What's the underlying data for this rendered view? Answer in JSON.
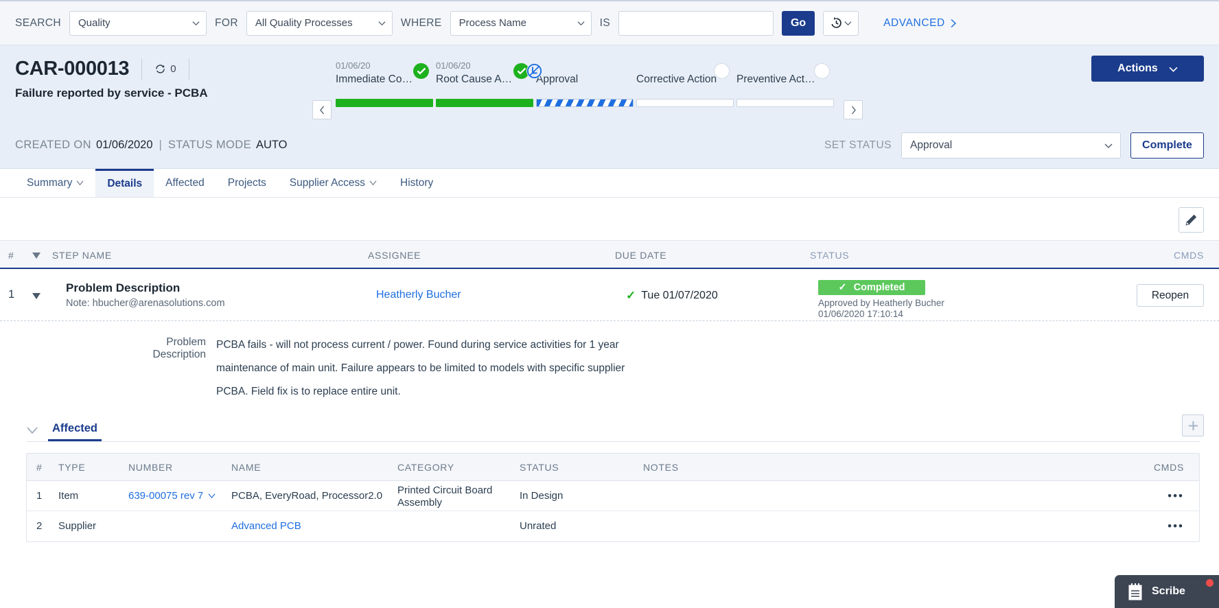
{
  "search": {
    "label_search": "SEARCH",
    "label_for": "FOR",
    "label_where": "WHERE",
    "label_is": "IS",
    "scope_value": "Quality",
    "scope_options": [
      "Quality"
    ],
    "for_value": "All Quality Processes",
    "for_options": [
      "All Quality Processes"
    ],
    "where_value": "Process Name",
    "where_options": [
      "Process Name"
    ],
    "query_value": "",
    "query_placeholder": "",
    "go_label": "Go",
    "history_icon": "history-clock-icon",
    "advanced_label": "ADVANCED"
  },
  "object_header": {
    "id": "CAR-000013",
    "revision_icon": "revision-loop-icon",
    "revision_count": "0",
    "subtitle": "Failure reported by service - PCBA",
    "actions_label": "Actions"
  },
  "workflow": {
    "prev_label": "‹",
    "next_label": "›",
    "steps": [
      {
        "date": "01/06/20",
        "name": "Immediate Co…",
        "state": "done",
        "badge": "check-circle-icon"
      },
      {
        "date": "01/06/20",
        "name": "Root Cause A…",
        "state": "done",
        "badge": "check-circle-icon"
      },
      {
        "date": "",
        "name": "Approval",
        "state": "active",
        "badge": "in-progress-icon"
      },
      {
        "date": "",
        "name": "Corrective Action",
        "state": "todo",
        "badge": "empty-circle-icon"
      },
      {
        "date": "",
        "name": "Preventive Act…",
        "state": "todo",
        "badge": "empty-circle-icon"
      }
    ]
  },
  "meta": {
    "created_label": "CREATED ON",
    "created_value": "01/06/2020",
    "pipe": "|",
    "status_mode_label": "STATUS MODE",
    "status_mode_value": "AUTO",
    "set_status_label": "SET STATUS",
    "set_status_value": "Approval",
    "set_status_options": [
      "Approval"
    ],
    "complete_label": "Complete"
  },
  "tabs": [
    {
      "label": "Summary",
      "active": false,
      "caret": true
    },
    {
      "label": "Details",
      "active": true,
      "caret": false
    },
    {
      "label": "Affected",
      "active": false,
      "caret": false
    },
    {
      "label": "Projects",
      "active": false,
      "caret": false
    },
    {
      "label": "Supplier Access",
      "active": false,
      "caret": true
    },
    {
      "label": "History",
      "active": false,
      "caret": false
    }
  ],
  "edit_row": {
    "pencil_icon": "pencil-edit-icon"
  },
  "steps_table": {
    "headers": {
      "num": "#",
      "step_name": "STEP NAME",
      "assignee": "ASSIGNEE",
      "due_date": "DUE DATE",
      "status": "STATUS",
      "cmds": "CMDS"
    },
    "row": {
      "num": "1",
      "name": "Problem Description",
      "note": "Note: hbucher@arenasolutions.com",
      "assignee": "Heatherly Bucher",
      "due_date": "Tue 01/07/2020",
      "due_check": "✓",
      "status_badge": "Completed",
      "status_check": "✓",
      "approved_by": "Approved by Heatherly Bucher",
      "approved_at": "01/06/2020 17:10:14",
      "cmd_label": "Reopen"
    }
  },
  "detail": {
    "field_label": "Problem Description",
    "lines": [
      "PCBA fails - will not process current / power. Found during service activities for 1 year",
      "maintenance of main unit. Failure appears to be limited to models with specific supplier",
      "PCBA. Field fix is to replace entire unit."
    ]
  },
  "affected": {
    "section_title": "Affected",
    "add_icon": "plus-icon",
    "collapse_icon": "chevron-down-icon",
    "headers": {
      "num": "#",
      "type": "TYPE",
      "number": "NUMBER",
      "name": "NAME",
      "category": "CATEGORY",
      "status": "STATUS",
      "notes": "NOTES",
      "cmds": "CMDS"
    },
    "rows": [
      {
        "num": "1",
        "type": "Item",
        "number": "639-00075 rev 7",
        "number_is_link": true,
        "number_caret": true,
        "name": "PCBA, EveryRoad, Processor2.0",
        "name_is_link": false,
        "category_line1": "Printed Circuit Board",
        "category_line2": "Assembly",
        "status": "In Design",
        "notes": "",
        "cmds": "•••"
      },
      {
        "num": "2",
        "type": "Supplier",
        "number": "",
        "number_is_link": false,
        "number_caret": false,
        "name": "Advanced PCB",
        "name_is_link": true,
        "category_line1": "",
        "category_line2": "",
        "status": "Unrated",
        "notes": "",
        "cmds": "•••"
      }
    ]
  },
  "scribe": {
    "label": "Scribe",
    "icon": "notepad-icon",
    "badge_color": "#ef4b4b"
  },
  "colors": {
    "brand_navy": "#1b3c8c",
    "link_blue": "#1f6fe0",
    "success_green": "#1eb11e",
    "badge_green": "#5cc85c",
    "header_bg": "#e8eef7",
    "toolbar_bg": "#f4f6fa"
  }
}
